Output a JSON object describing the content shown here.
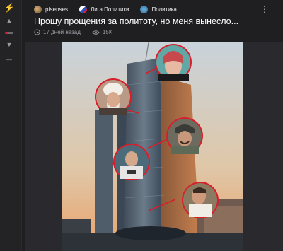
{
  "header": {
    "author": "pfsenses",
    "community": "Лига Политики",
    "tag": "Политика",
    "more": "⋮"
  },
  "post": {
    "title": "Прошу прощения за политоту, но меня вынесло...",
    "time": "17 дней назад",
    "views": "15K"
  },
  "leftbar": {
    "bolt": "⚡",
    "up": "▲",
    "down": "▼",
    "dash": "—"
  },
  "colors": {
    "background": "#1f1f22",
    "accent_red": "#d81e2a",
    "sky_top": "#cfd6dc",
    "sky_bottom": "#e9b07a"
  },
  "icons": [
    "bolt-icon",
    "upvote-icon",
    "rating-bar-icon",
    "downvote-icon",
    "collapse-dash-icon",
    "more-icon",
    "clock-icon",
    "eye-icon"
  ]
}
